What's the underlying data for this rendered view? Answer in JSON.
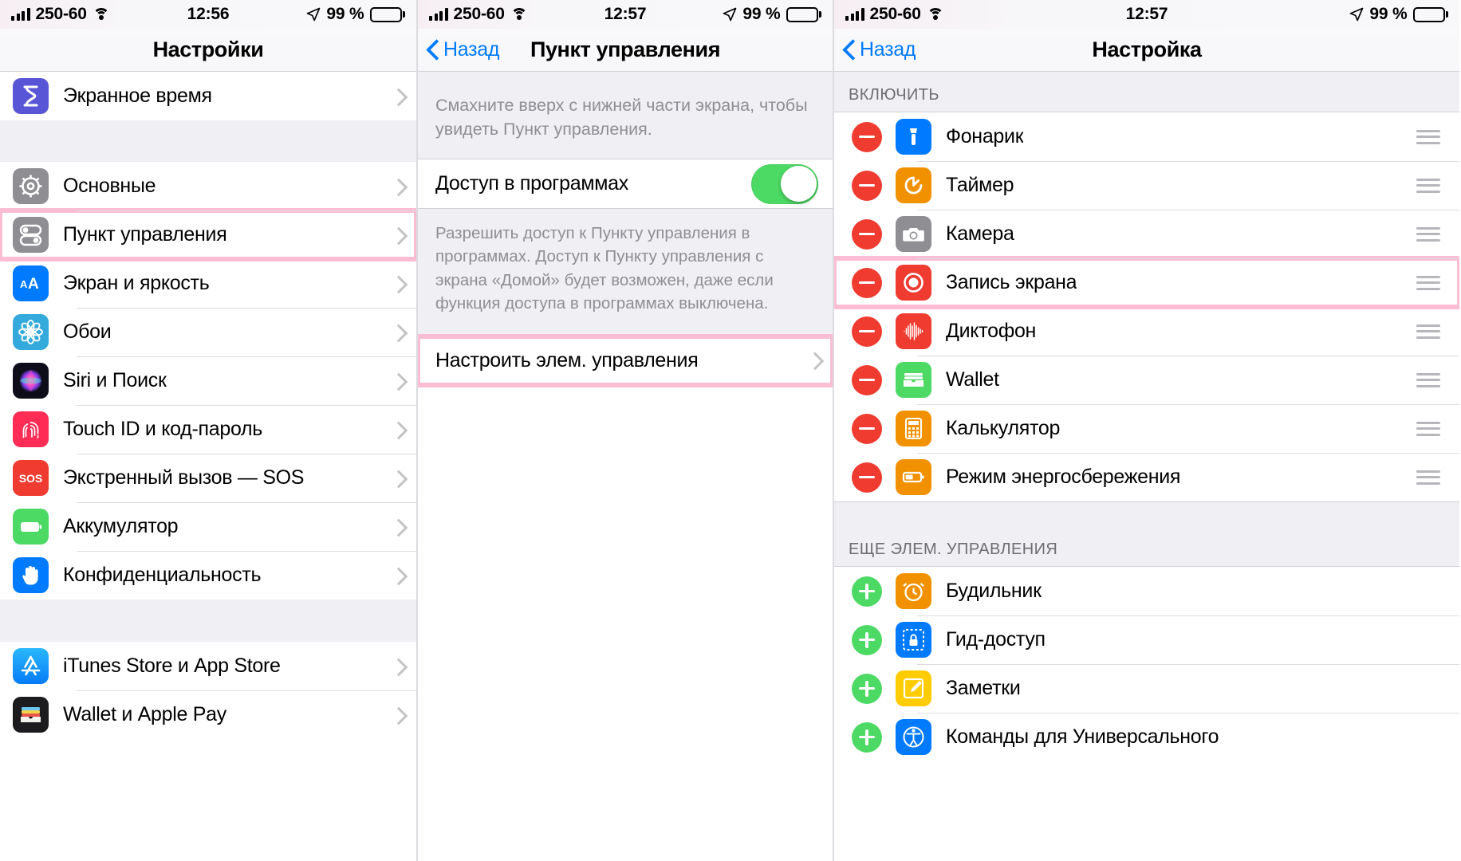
{
  "colors": {
    "highlight": "#fbbdd3",
    "blue": "#007aff",
    "green": "#4cd964",
    "red": "#ef3b30",
    "group_bg": "#efeff4",
    "separator": "#dcdcdf",
    "secondary_text": "#8e8e93"
  },
  "panels": [
    {
      "id": "settings",
      "status": {
        "carrier": "250-60",
        "time": "12:56",
        "battery_percent": "99 %",
        "signal_icon": "cellular-bars-icon",
        "wifi_icon": "wifi-icon",
        "location_icon": "location-arrow-icon",
        "battery_icon": "battery-full-icon"
      },
      "nav": {
        "title": "Настройки",
        "back_label": null
      },
      "groups": [
        {
          "rows": [
            {
              "label": "Экранное время",
              "icon": "screen-time-icon",
              "chevron": true,
              "highlighted": false
            }
          ]
        },
        {
          "rows": [
            {
              "label": "Основные",
              "icon": "general-gear-icon",
              "chevron": true,
              "highlighted": false
            },
            {
              "label": "Пункт управления",
              "icon": "control-center-icon",
              "chevron": true,
              "highlighted": true
            },
            {
              "label": "Экран и яркость",
              "icon": "display-brightness-icon",
              "chevron": true,
              "highlighted": false
            },
            {
              "label": "Обои",
              "icon": "wallpaper-icon",
              "chevron": true,
              "highlighted": false
            },
            {
              "label": "Siri и Поиск",
              "icon": "siri-icon",
              "chevron": true,
              "highlighted": false
            },
            {
              "label": "Touch ID и код-пароль",
              "icon": "touch-id-icon",
              "chevron": true,
              "highlighted": false
            },
            {
              "label": "Экстренный вызов — SOS",
              "icon": "sos-icon",
              "chevron": true,
              "highlighted": false
            },
            {
              "label": "Аккумулятор",
              "icon": "battery-icon",
              "chevron": true,
              "highlighted": false
            },
            {
              "label": "Конфиденциальность",
              "icon": "privacy-hand-icon",
              "chevron": true,
              "highlighted": false
            }
          ]
        },
        {
          "rows": [
            {
              "label": "iTunes Store и App Store",
              "icon": "app-store-icon",
              "chevron": true,
              "highlighted": false
            },
            {
              "label": "Wallet и Apple Pay",
              "icon": "wallet-icon",
              "chevron": true,
              "highlighted": false
            }
          ]
        }
      ]
    },
    {
      "id": "control-center",
      "status": {
        "carrier": "250-60",
        "time": "12:57",
        "battery_percent": "99 %",
        "signal_icon": "cellular-bars-icon",
        "wifi_icon": "wifi-icon",
        "location_icon": "location-arrow-icon",
        "battery_icon": "battery-full-icon"
      },
      "nav": {
        "title": "Пункт управления",
        "back_label": "Назад"
      },
      "hint": "Смахните вверх с нижней части экрана, чтобы увидеть Пункт управления.",
      "toggle_row": {
        "label": "Доступ в программах",
        "value": "on"
      },
      "footnote": "Разрешить доступ к Пункту управления в программах. Доступ к Пункту управления с экрана «Домой» будет возможен, даже если функция доступа в программах выключена.",
      "customize_row": {
        "label": "Настроить элем. управления",
        "chevron": true,
        "highlighted": true
      }
    },
    {
      "id": "customize",
      "status": {
        "carrier": "250-60",
        "time": "12:57",
        "battery_percent": "99 %",
        "signal_icon": "cellular-bars-icon",
        "wifi_icon": "wifi-icon",
        "location_icon": "location-arrow-icon",
        "battery_icon": "battery-full-icon"
      },
      "nav": {
        "title": "Настройка",
        "back_label": "Назад"
      },
      "sections": [
        {
          "header": "ВКЛЮЧИТЬ",
          "action": "minus",
          "rows": [
            {
              "label": "Фонарик",
              "icon": "flashlight-icon",
              "highlighted": false
            },
            {
              "label": "Таймер",
              "icon": "timer-icon",
              "highlighted": false
            },
            {
              "label": "Камера",
              "icon": "camera-icon",
              "highlighted": false
            },
            {
              "label": "Запись экрана",
              "icon": "screen-record-icon",
              "highlighted": true
            },
            {
              "label": "Диктофон",
              "icon": "voice-memos-icon",
              "highlighted": false
            },
            {
              "label": "Wallet",
              "icon": "wallet-icon",
              "highlighted": false
            },
            {
              "label": "Калькулятор",
              "icon": "calculator-icon",
              "highlighted": false
            },
            {
              "label": "Режим энергосбережения",
              "icon": "low-power-icon",
              "highlighted": false
            }
          ]
        },
        {
          "header": "ЕЩЕ ЭЛЕМ. УПРАВЛЕНИЯ",
          "action": "plus",
          "rows": [
            {
              "label": "Будильник",
              "icon": "alarm-clock-icon",
              "highlighted": false
            },
            {
              "label": "Гид-доступ",
              "icon": "guided-access-icon",
              "highlighted": false
            },
            {
              "label": "Заметки",
              "icon": "notes-icon",
              "highlighted": false
            },
            {
              "label": "Команды для Универсального",
              "icon": "accessibility-icon",
              "highlighted": false
            }
          ]
        }
      ]
    }
  ]
}
